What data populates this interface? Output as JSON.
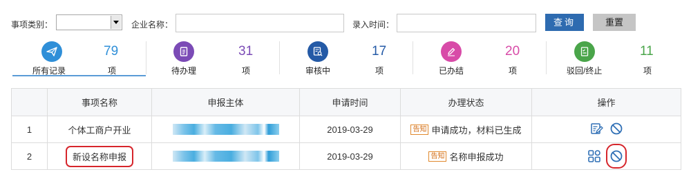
{
  "filters": {
    "category_label": "事项类别：",
    "category_value": "",
    "company_label": "企业名称：",
    "company_value": "",
    "time_label": "录入时间：",
    "time_value": "",
    "query_button": "查询",
    "reset_button": "重置"
  },
  "summary": [
    {
      "label": "所有记录",
      "count": "79",
      "unit": "项",
      "icon": "send-icon",
      "color": "#2f8fd8",
      "active": true
    },
    {
      "label": "待办理",
      "count": "31",
      "unit": "项",
      "icon": "document-list-icon",
      "color": "#7b4bb6"
    },
    {
      "label": "审核中",
      "count": "17",
      "unit": "项",
      "icon": "review-document-icon",
      "color": "#245aa6"
    },
    {
      "label": "已办结",
      "count": "20",
      "unit": "项",
      "icon": "pen-icon",
      "color": "#d84ba8"
    },
    {
      "label": "驳回/终止",
      "count": "11",
      "unit": "项",
      "icon": "checklist-icon",
      "color": "#4aa54a"
    }
  ],
  "table": {
    "headers": [
      "",
      "事项名称",
      "申报主体",
      "申请时间",
      "办理状态",
      "操作"
    ],
    "rows": [
      {
        "index": "1",
        "name": "个体工商户开业",
        "date": "2019-03-29",
        "tag": "告知",
        "status": "申请成功，材料已生成",
        "actions": [
          "edit-form-icon",
          "cancel-icon"
        ]
      },
      {
        "index": "2",
        "name": "新设名称申报",
        "date": "2019-03-29",
        "tag": "告知",
        "status": "名称申报成功",
        "actions": [
          "grid-apps-icon",
          "cancel-icon"
        ]
      }
    ]
  }
}
